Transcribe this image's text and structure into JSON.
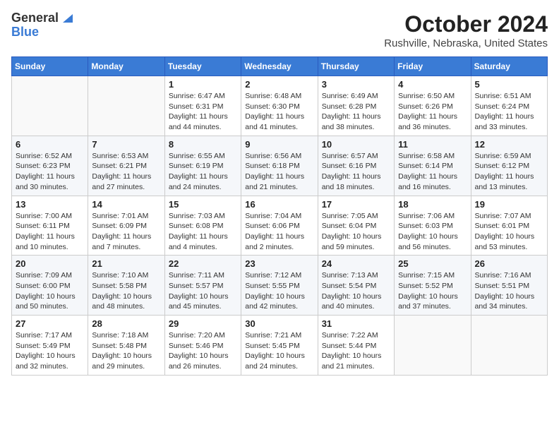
{
  "header": {
    "logo_general": "General",
    "logo_blue": "Blue",
    "month_title": "October 2024",
    "location": "Rushville, Nebraska, United States"
  },
  "days_of_week": [
    "Sunday",
    "Monday",
    "Tuesday",
    "Wednesday",
    "Thursday",
    "Friday",
    "Saturday"
  ],
  "weeks": [
    [
      {
        "day": "",
        "sunrise": "",
        "sunset": "",
        "daylight": ""
      },
      {
        "day": "",
        "sunrise": "",
        "sunset": "",
        "daylight": ""
      },
      {
        "day": "1",
        "sunrise": "Sunrise: 6:47 AM",
        "sunset": "Sunset: 6:31 PM",
        "daylight": "Daylight: 11 hours and 44 minutes."
      },
      {
        "day": "2",
        "sunrise": "Sunrise: 6:48 AM",
        "sunset": "Sunset: 6:30 PM",
        "daylight": "Daylight: 11 hours and 41 minutes."
      },
      {
        "day": "3",
        "sunrise": "Sunrise: 6:49 AM",
        "sunset": "Sunset: 6:28 PM",
        "daylight": "Daylight: 11 hours and 38 minutes."
      },
      {
        "day": "4",
        "sunrise": "Sunrise: 6:50 AM",
        "sunset": "Sunset: 6:26 PM",
        "daylight": "Daylight: 11 hours and 36 minutes."
      },
      {
        "day": "5",
        "sunrise": "Sunrise: 6:51 AM",
        "sunset": "Sunset: 6:24 PM",
        "daylight": "Daylight: 11 hours and 33 minutes."
      }
    ],
    [
      {
        "day": "6",
        "sunrise": "Sunrise: 6:52 AM",
        "sunset": "Sunset: 6:23 PM",
        "daylight": "Daylight: 11 hours and 30 minutes."
      },
      {
        "day": "7",
        "sunrise": "Sunrise: 6:53 AM",
        "sunset": "Sunset: 6:21 PM",
        "daylight": "Daylight: 11 hours and 27 minutes."
      },
      {
        "day": "8",
        "sunrise": "Sunrise: 6:55 AM",
        "sunset": "Sunset: 6:19 PM",
        "daylight": "Daylight: 11 hours and 24 minutes."
      },
      {
        "day": "9",
        "sunrise": "Sunrise: 6:56 AM",
        "sunset": "Sunset: 6:18 PM",
        "daylight": "Daylight: 11 hours and 21 minutes."
      },
      {
        "day": "10",
        "sunrise": "Sunrise: 6:57 AM",
        "sunset": "Sunset: 6:16 PM",
        "daylight": "Daylight: 11 hours and 18 minutes."
      },
      {
        "day": "11",
        "sunrise": "Sunrise: 6:58 AM",
        "sunset": "Sunset: 6:14 PM",
        "daylight": "Daylight: 11 hours and 16 minutes."
      },
      {
        "day": "12",
        "sunrise": "Sunrise: 6:59 AM",
        "sunset": "Sunset: 6:12 PM",
        "daylight": "Daylight: 11 hours and 13 minutes."
      }
    ],
    [
      {
        "day": "13",
        "sunrise": "Sunrise: 7:00 AM",
        "sunset": "Sunset: 6:11 PM",
        "daylight": "Daylight: 11 hours and 10 minutes."
      },
      {
        "day": "14",
        "sunrise": "Sunrise: 7:01 AM",
        "sunset": "Sunset: 6:09 PM",
        "daylight": "Daylight: 11 hours and 7 minutes."
      },
      {
        "day": "15",
        "sunrise": "Sunrise: 7:03 AM",
        "sunset": "Sunset: 6:08 PM",
        "daylight": "Daylight: 11 hours and 4 minutes."
      },
      {
        "day": "16",
        "sunrise": "Sunrise: 7:04 AM",
        "sunset": "Sunset: 6:06 PM",
        "daylight": "Daylight: 11 hours and 2 minutes."
      },
      {
        "day": "17",
        "sunrise": "Sunrise: 7:05 AM",
        "sunset": "Sunset: 6:04 PM",
        "daylight": "Daylight: 10 hours and 59 minutes."
      },
      {
        "day": "18",
        "sunrise": "Sunrise: 7:06 AM",
        "sunset": "Sunset: 6:03 PM",
        "daylight": "Daylight: 10 hours and 56 minutes."
      },
      {
        "day": "19",
        "sunrise": "Sunrise: 7:07 AM",
        "sunset": "Sunset: 6:01 PM",
        "daylight": "Daylight: 10 hours and 53 minutes."
      }
    ],
    [
      {
        "day": "20",
        "sunrise": "Sunrise: 7:09 AM",
        "sunset": "Sunset: 6:00 PM",
        "daylight": "Daylight: 10 hours and 50 minutes."
      },
      {
        "day": "21",
        "sunrise": "Sunrise: 7:10 AM",
        "sunset": "Sunset: 5:58 PM",
        "daylight": "Daylight: 10 hours and 48 minutes."
      },
      {
        "day": "22",
        "sunrise": "Sunrise: 7:11 AM",
        "sunset": "Sunset: 5:57 PM",
        "daylight": "Daylight: 10 hours and 45 minutes."
      },
      {
        "day": "23",
        "sunrise": "Sunrise: 7:12 AM",
        "sunset": "Sunset: 5:55 PM",
        "daylight": "Daylight: 10 hours and 42 minutes."
      },
      {
        "day": "24",
        "sunrise": "Sunrise: 7:13 AM",
        "sunset": "Sunset: 5:54 PM",
        "daylight": "Daylight: 10 hours and 40 minutes."
      },
      {
        "day": "25",
        "sunrise": "Sunrise: 7:15 AM",
        "sunset": "Sunset: 5:52 PM",
        "daylight": "Daylight: 10 hours and 37 minutes."
      },
      {
        "day": "26",
        "sunrise": "Sunrise: 7:16 AM",
        "sunset": "Sunset: 5:51 PM",
        "daylight": "Daylight: 10 hours and 34 minutes."
      }
    ],
    [
      {
        "day": "27",
        "sunrise": "Sunrise: 7:17 AM",
        "sunset": "Sunset: 5:49 PM",
        "daylight": "Daylight: 10 hours and 32 minutes."
      },
      {
        "day": "28",
        "sunrise": "Sunrise: 7:18 AM",
        "sunset": "Sunset: 5:48 PM",
        "daylight": "Daylight: 10 hours and 29 minutes."
      },
      {
        "day": "29",
        "sunrise": "Sunrise: 7:20 AM",
        "sunset": "Sunset: 5:46 PM",
        "daylight": "Daylight: 10 hours and 26 minutes."
      },
      {
        "day": "30",
        "sunrise": "Sunrise: 7:21 AM",
        "sunset": "Sunset: 5:45 PM",
        "daylight": "Daylight: 10 hours and 24 minutes."
      },
      {
        "day": "31",
        "sunrise": "Sunrise: 7:22 AM",
        "sunset": "Sunset: 5:44 PM",
        "daylight": "Daylight: 10 hours and 21 minutes."
      },
      {
        "day": "",
        "sunrise": "",
        "sunset": "",
        "daylight": ""
      },
      {
        "day": "",
        "sunrise": "",
        "sunset": "",
        "daylight": ""
      }
    ]
  ]
}
